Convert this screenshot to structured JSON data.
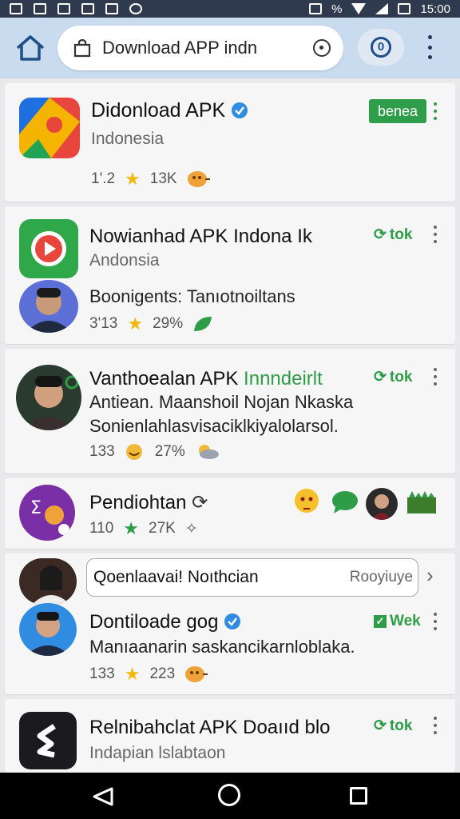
{
  "status": {
    "time": "15:00",
    "battery": "%"
  },
  "url": {
    "text": "Download APP indn"
  },
  "cards": [
    {
      "title": "Didonload APK",
      "subtitle": "Indonesia",
      "meta1": "1'.2",
      "meta2": "13K",
      "action": "benea"
    },
    {
      "title": "Nowianhad APK Indona Ik",
      "subtitle": "Andonsia",
      "desc": "Boonigents: Tanıotnoiltans",
      "meta1": "3'13",
      "meta2": "29%",
      "action": "tok"
    },
    {
      "title_main": "Vanthoealan APK",
      "title_accent": "Innndeirlt",
      "desc1": "Antiean. Maanshoil Nojan Nkaska",
      "desc2": "Sonienlahlasvisaciklkiyalolarsol.",
      "meta1": "133",
      "meta2": "27%",
      "action": "tok"
    },
    {
      "title": "Pendiohtan",
      "meta1": "110",
      "meta2": "27K"
    },
    {
      "search_text": "Qoenlaavai! Noıthcian",
      "search_hint": "Rooyiuye",
      "title": "Dontiloade gog",
      "desc": "Manıaanarin saskancikarnloblaka.",
      "meta1": "133",
      "meta2": "223",
      "action": "Wek"
    },
    {
      "title": "Relnibahclat APK Doaııd blo",
      "subtitle": "Indapian lslabtaon",
      "action": "tok"
    }
  ],
  "colors": {
    "accent": "#2e9d47",
    "star": "#f2b90c",
    "toolbar": "#c9dcef",
    "status": "#2f3a4f"
  }
}
